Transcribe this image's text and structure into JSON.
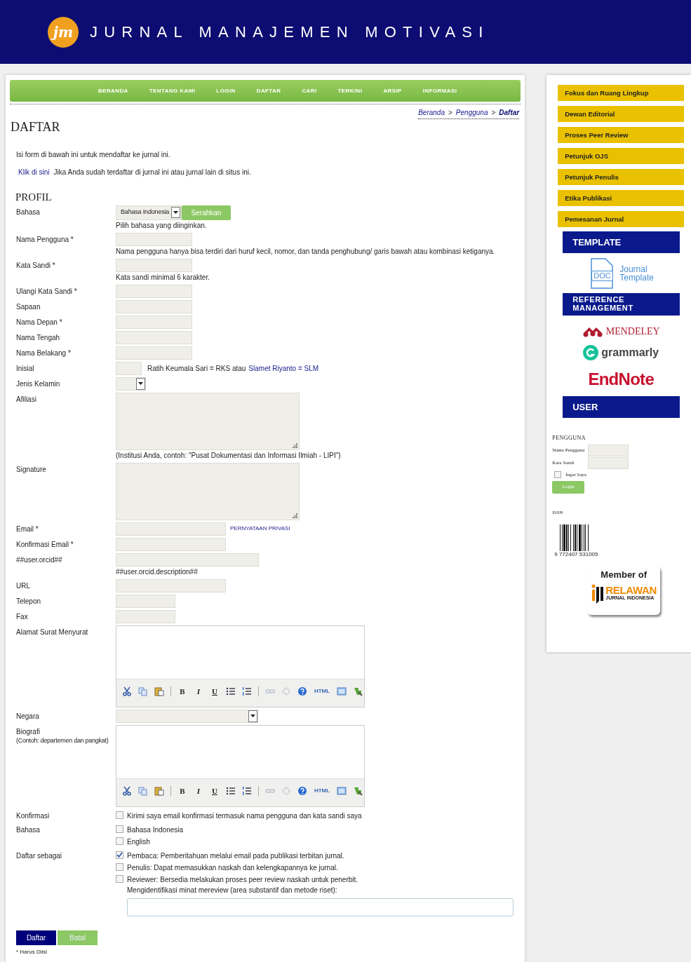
{
  "header": {
    "logo_mark": "jm",
    "title": "JURNAL MANAJEMEN MOTIVASI"
  },
  "nav": [
    "BERANDA",
    "TENTANG KAMI",
    "LOGIN",
    "DAFTAR",
    "CARI",
    "TERKINI",
    "ARSIP",
    "INFORMASI"
  ],
  "breadcrumb": {
    "separator": ">",
    "items": [
      {
        "label": "Beranda",
        "current": false
      },
      {
        "label": "Pengguna",
        "current": false
      },
      {
        "label": "Daftar",
        "current": true
      }
    ]
  },
  "page_title": "DAFTAR",
  "intro": "Isi form di bawah ini untuk mendaftar ke jurnal ini.",
  "login_hint": {
    "link": "Klik di sini",
    "text": "Jika Anda sudah terdaftar di jurnal ini atau jurnal lain di situs ini."
  },
  "section_title": "PROFIL",
  "fields": [
    {
      "kind": "language",
      "label": "Bahasa",
      "value": "Bahasa Indonesia",
      "button": "Serahkan",
      "hint": "Pilih bahasa yang diinginkan."
    },
    {
      "kind": "short_text",
      "label": "Nama Pengguna *",
      "hint": "Nama pengguna hanya bisa terdiri dari huruf kecil, nomor, dan tanda penghubung/ garis bawah atau kombinasi ketiganya."
    },
    {
      "kind": "short_text",
      "label": "Kata Sandi *",
      "hint": "Kata sandi minimal 6 karakter."
    },
    {
      "kind": "short_text",
      "label": "Ulangi Kata Sandi *"
    },
    {
      "kind": "short_text",
      "label": "Sapaan"
    },
    {
      "kind": "short_text",
      "label": "Nama Depan *"
    },
    {
      "kind": "short_text",
      "label": "Nama Tengah"
    },
    {
      "kind": "short_text",
      "label": "Nama Belakang *"
    },
    {
      "kind": "initials_text",
      "label": "Inisial",
      "note": "Ratih Keumala Sari = RKS atau",
      "note_link": "Slamet Riyanto = SLM"
    },
    {
      "kind": "small_select",
      "label": "Jenis Kelamin"
    },
    {
      "kind": "textarea",
      "label": "Afiliasi",
      "hint": "(Institusi Anda, contoh: \"Pusat Dokumentasi dan Informasi Ilmiah - LIPI\")"
    },
    {
      "kind": "textarea",
      "label": "Signature"
    },
    {
      "kind": "text",
      "label": "Email *",
      "link": "PERNYATAAN PRIVASI"
    },
    {
      "kind": "text",
      "label": "Konfirmasi Email *"
    },
    {
      "kind": "wide_text",
      "label": "##user.orcid##",
      "hint": "##user.orcid.description##"
    },
    {
      "kind": "text",
      "label": "URL"
    },
    {
      "kind": "phone_text",
      "label": "Telepon"
    },
    {
      "kind": "phone_text",
      "label": "Fax"
    },
    {
      "kind": "editor",
      "label": "Alamat Surat Menyurat",
      "toolbar": [
        {
          "kind": "cut"
        },
        {
          "kind": "copy"
        },
        {
          "kind": "paste"
        },
        {
          "kind": "separator"
        },
        {
          "kind": "bold",
          "label": "B"
        },
        {
          "kind": "italic",
          "label": "I"
        },
        {
          "kind": "underline",
          "label": "U"
        },
        {
          "kind": "bullets"
        },
        {
          "kind": "numbers"
        },
        {
          "kind": "separator"
        },
        {
          "kind": "link"
        },
        {
          "kind": "unlink"
        },
        {
          "kind": "help"
        },
        {
          "kind": "html",
          "label": "HTML"
        },
        {
          "kind": "image"
        },
        {
          "kind": "plugin"
        }
      ]
    },
    {
      "kind": "select",
      "label": "Negara"
    },
    {
      "kind": "editor",
      "label": "Biografi",
      "sublabel": "(Contoh: departemen dan pangkat)",
      "toolbar": [
        {
          "kind": "cut"
        },
        {
          "kind": "copy"
        },
        {
          "kind": "paste"
        },
        {
          "kind": "separator"
        },
        {
          "kind": "bold",
          "label": "B"
        },
        {
          "kind": "italic",
          "label": "I"
        },
        {
          "kind": "underline",
          "label": "U"
        },
        {
          "kind": "bullets"
        },
        {
          "kind": "numbers"
        },
        {
          "kind": "separator"
        },
        {
          "kind": "link"
        },
        {
          "kind": "unlink"
        },
        {
          "kind": "help"
        },
        {
          "kind": "html",
          "label": "HTML"
        },
        {
          "kind": "image"
        },
        {
          "kind": "plugin"
        }
      ]
    },
    {
      "kind": "checkboxes",
      "label": "Konfirmasi",
      "options": [
        {
          "label": "Kirimi saya email konfirmasi termasuk nama pengguna dan kata sandi saya",
          "checked": false
        }
      ]
    },
    {
      "kind": "checkboxes",
      "label": "Bahasa",
      "options": [
        {
          "label": "Bahasa Indonesia",
          "checked": false
        },
        {
          "label": "English",
          "checked": false
        }
      ]
    },
    {
      "kind": "checkboxes",
      "label": "Daftar sebagai",
      "options": [
        {
          "label": "Pembaca: Pemberitahuan melalui email pada publikasi terbitan jurnal.",
          "checked": true
        },
        {
          "label": "Penulis: Dapat memasukkan naskah dan kelengkapannya ke jurnal.",
          "checked": false
        },
        {
          "label": "Reviewer: Bersedia melakukan proses peer review naskah untuk penerbit.",
          "checked": false,
          "note": "Mengidentifikasi minat mereview (area substantif dan metode riset):",
          "has_interests_field": true
        }
      ]
    }
  ],
  "buttons": [
    {
      "kind": "primary",
      "label": "Daftar"
    },
    {
      "kind": "secondary",
      "label": "Batal"
    }
  ],
  "required_note": "* Harus Diisi",
  "sidebar": {
    "links": [
      "Fokus dan Ruang Lingkup",
      "Dewan Editorial",
      "Proses Peer Review",
      "Petunjuk OJS",
      "Petunjuk Penulis",
      "Etika Publikasi",
      "Pemesanan Jurnal"
    ],
    "template_heading": "TEMPLATE",
    "template_link": {
      "badge": "DOC",
      "lines": [
        "Journal",
        "Template"
      ]
    },
    "reference_heading": "REFERENCE MANAGEMENT",
    "tools": [
      {
        "kind": "mendeley",
        "name": "MENDELEY"
      },
      {
        "kind": "grammarly",
        "name": "grammarly"
      },
      {
        "kind": "endnote",
        "name": "EndNote"
      }
    ],
    "user_heading": "USER",
    "login": {
      "title": "PENGGUNA",
      "fields": [
        "Nama Pengguna",
        "Kata Sandi"
      ],
      "remember": {
        "label": "Ingat Saya",
        "checked": false
      },
      "button": "Login"
    },
    "issn": {
      "label": "ISSN",
      "barcode_number": "9 772407 531005"
    },
    "member": {
      "title": "Member of",
      "org_name": "RELAWAN",
      "org_subtitle": "JURNAL INDONESIA"
    }
  }
}
